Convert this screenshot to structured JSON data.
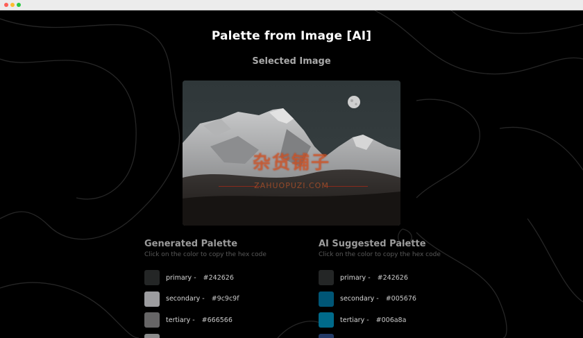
{
  "app": {
    "title": "Palette from Image [AI]",
    "selected_image_label": "Selected Image"
  },
  "image": {
    "description_icon": "mountain-photo",
    "watermark": "杂货铺子",
    "watermark_sub": "ZAHUOPUZI.COM"
  },
  "generated_palette": {
    "heading": "Generated Palette",
    "hint": "Click on the color to copy the hex code",
    "colors": [
      {
        "name": "primary -",
        "hex": "#242626",
        "swatch": "#242626"
      },
      {
        "name": "secondary -",
        "hex": "#9c9c9f",
        "swatch": "#9c9c9f"
      },
      {
        "name": "tertiary -",
        "hex": "#666566",
        "swatch": "#666566"
      },
      {
        "name": "",
        "hex": "",
        "swatch": "#8a8a8a"
      }
    ]
  },
  "ai_palette": {
    "heading": "AI Suggested Palette",
    "hint": "Click on the color to copy the hex code",
    "colors": [
      {
        "name": "primary -",
        "hex": "#242626",
        "swatch": "#242626"
      },
      {
        "name": "secondary -",
        "hex": "#005676",
        "swatch": "#005676"
      },
      {
        "name": "tertiary -",
        "hex": "#006a8a",
        "swatch": "#006a8a"
      },
      {
        "name": "",
        "hex": "",
        "swatch": "#233a66"
      }
    ]
  },
  "colors": {
    "background": "#000000",
    "title": "#ffffff",
    "muted": "#a9a9a9"
  }
}
